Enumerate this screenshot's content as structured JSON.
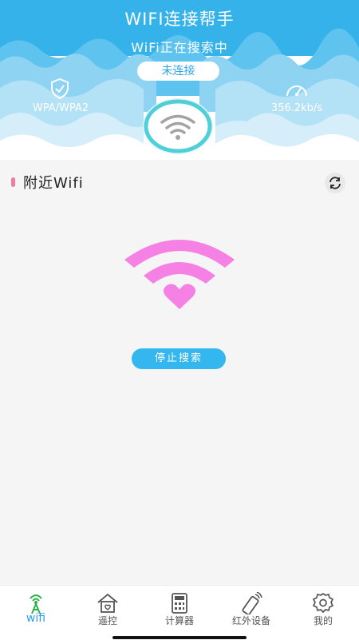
{
  "header": {
    "title": "WIFI连接帮手",
    "status": "WiFi正在搜索中",
    "connection_state": "未连接",
    "security": {
      "label": "WPA/WPA2",
      "icon": "shield-check-icon"
    },
    "speed": {
      "label": "356.2kb/s",
      "icon": "speedometer-icon"
    },
    "center_icon": "wifi-icon"
  },
  "section": {
    "title": "附近Wifi",
    "refresh_icon": "refresh-icon"
  },
  "main": {
    "illustration_icon": "heart-wifi-icon",
    "stop_button_label": "停止搜索"
  },
  "tabs": [
    {
      "label": "wifi",
      "icon": "wifi-tower-icon",
      "active": true
    },
    {
      "label": "遥控",
      "icon": "home-remote-icon",
      "active": false
    },
    {
      "label": "计算器",
      "icon": "calculator-icon",
      "active": false
    },
    {
      "label": "红外设备",
      "icon": "infrared-remote-icon",
      "active": false
    },
    {
      "label": "我的",
      "icon": "gear-icon",
      "active": false
    }
  ],
  "colors": {
    "primary": "#34b7ee",
    "accent_pink": "#f27aa7",
    "active_tab": "#2f9de8"
  }
}
